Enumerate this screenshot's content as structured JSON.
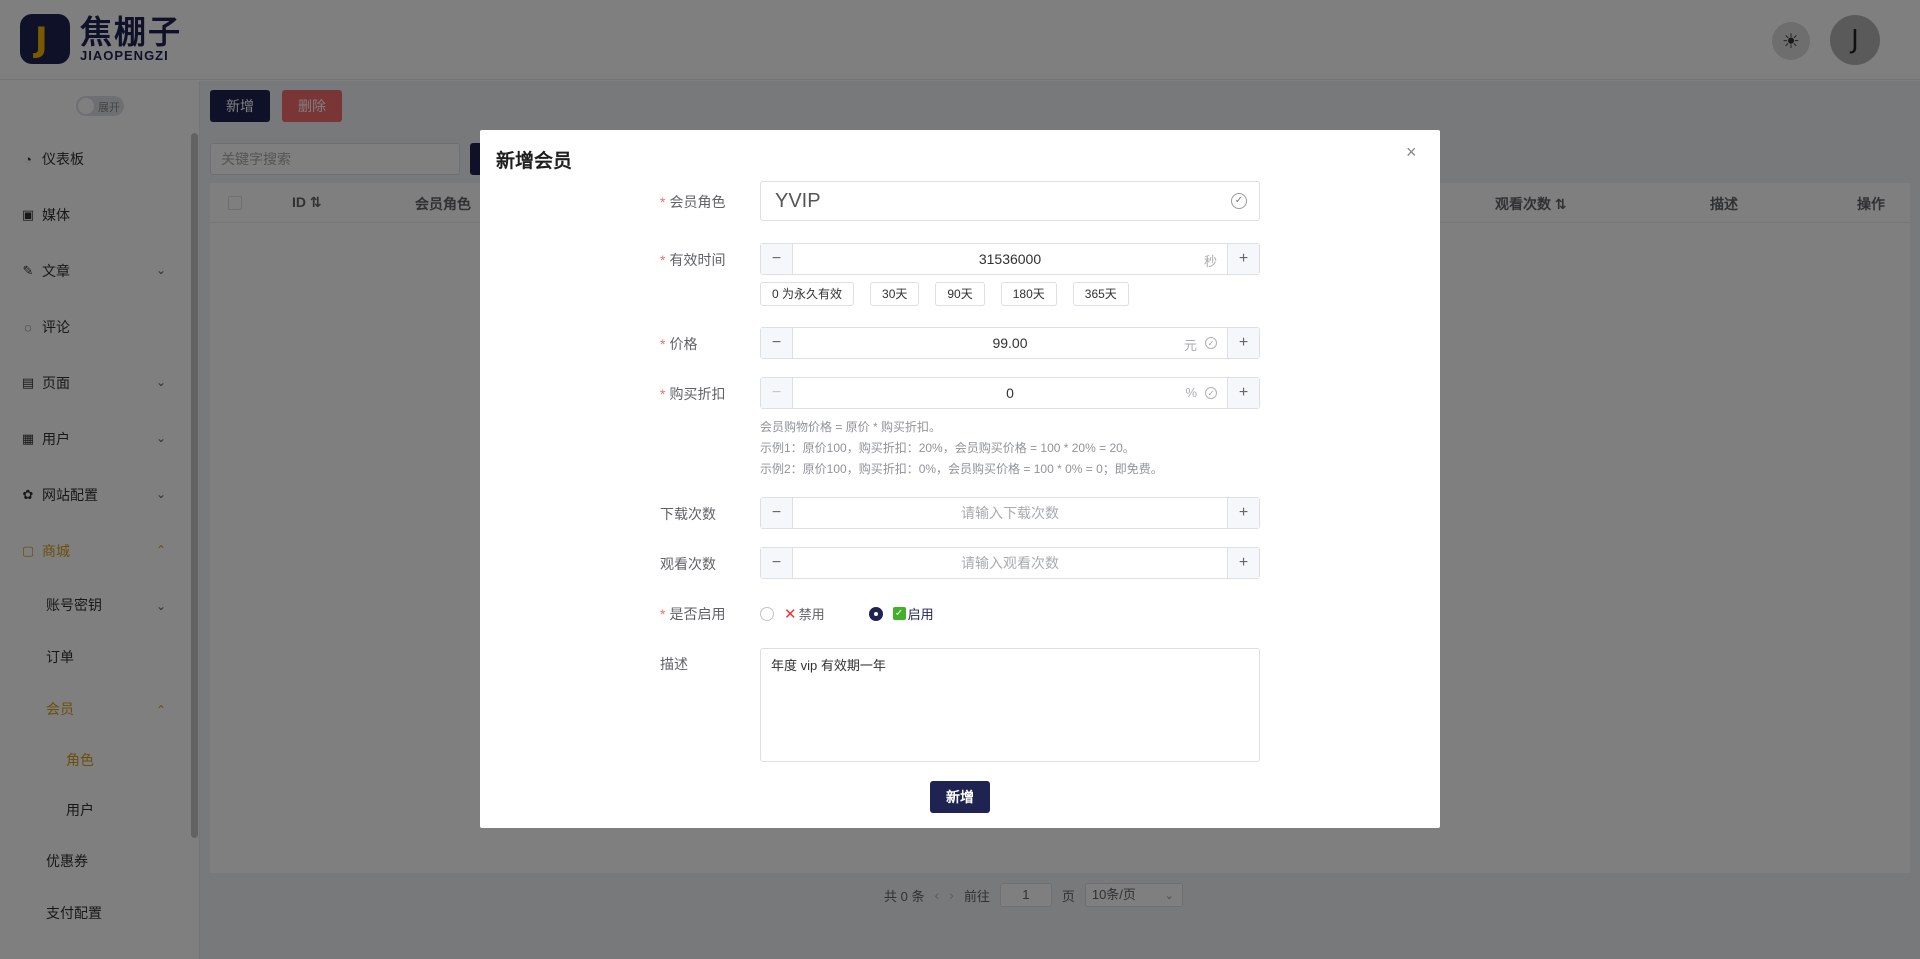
{
  "header": {
    "logo_letter": "J",
    "logo_cn": "焦棚子",
    "logo_en": "JIAOPENGZI",
    "avatar_letter": "J"
  },
  "sidebar": {
    "toggle_label": "展开",
    "items": [
      {
        "label": "仪表板",
        "icon": "dashboard-icon"
      },
      {
        "label": "媒体",
        "icon": "image-icon"
      },
      {
        "label": "文章",
        "icon": "edit-icon"
      },
      {
        "label": "评论",
        "icon": "comment-icon"
      },
      {
        "label": "页面",
        "icon": "page-icon"
      },
      {
        "label": "用户",
        "icon": "user-icon"
      },
      {
        "label": "网站配置",
        "icon": "settings-icon"
      },
      {
        "label": "商城",
        "icon": "shop-icon"
      },
      {
        "label": "账号密钥"
      },
      {
        "label": "订单"
      },
      {
        "label": "会员"
      },
      {
        "label": "角色"
      },
      {
        "label": "用户"
      },
      {
        "label": "优惠券"
      },
      {
        "label": "支付配置"
      }
    ]
  },
  "toolbar": {
    "add_label": "新增",
    "delete_label": "删除",
    "search_placeholder": "关键字搜索"
  },
  "table": {
    "columns": [
      "ID",
      "会员角色",
      "观看次数",
      "描述",
      "操作"
    ]
  },
  "pagination": {
    "total": "共 0 条",
    "goto_label": "前往",
    "page": "1",
    "page_suffix": "页",
    "page_size": "10条/页"
  },
  "dialog": {
    "title": "新增会员",
    "close": "×",
    "fields": {
      "role": {
        "label": "会员角色",
        "value": "YVIP"
      },
      "duration": {
        "label": "有效时间",
        "value": "31536000",
        "unit": "秒"
      },
      "duration_presets": [
        "0 为永久有效",
        "30天",
        "90天",
        "180天",
        "365天"
      ],
      "price": {
        "label": "价格",
        "value": "99.00",
        "unit": "元"
      },
      "discount": {
        "label": "购买折扣",
        "value": "0",
        "unit": "%"
      },
      "discount_hints": [
        "会员购物价格 = 原价 * 购买折扣。",
        "示例1：原价100，购买折扣：20%，会员购买价格 = 100 * 20% = 20。",
        "示例2：原价100，购买折扣：0%，会员购买价格 = 100 * 0% = 0；即免费。"
      ],
      "downloads": {
        "label": "下载次数",
        "placeholder": "请输入下载次数"
      },
      "views": {
        "label": "观看次数",
        "placeholder": "请输入观看次数"
      },
      "enabled": {
        "label": "是否启用",
        "options": [
          "禁用",
          "启用"
        ],
        "selected": "启用"
      },
      "description": {
        "label": "描述",
        "value": "年度 vip 有效期一年"
      }
    },
    "submit_label": "新增"
  },
  "colors": {
    "brand": "#1f2351",
    "accent": "#d4a017",
    "danger": "#f56c6c"
  }
}
